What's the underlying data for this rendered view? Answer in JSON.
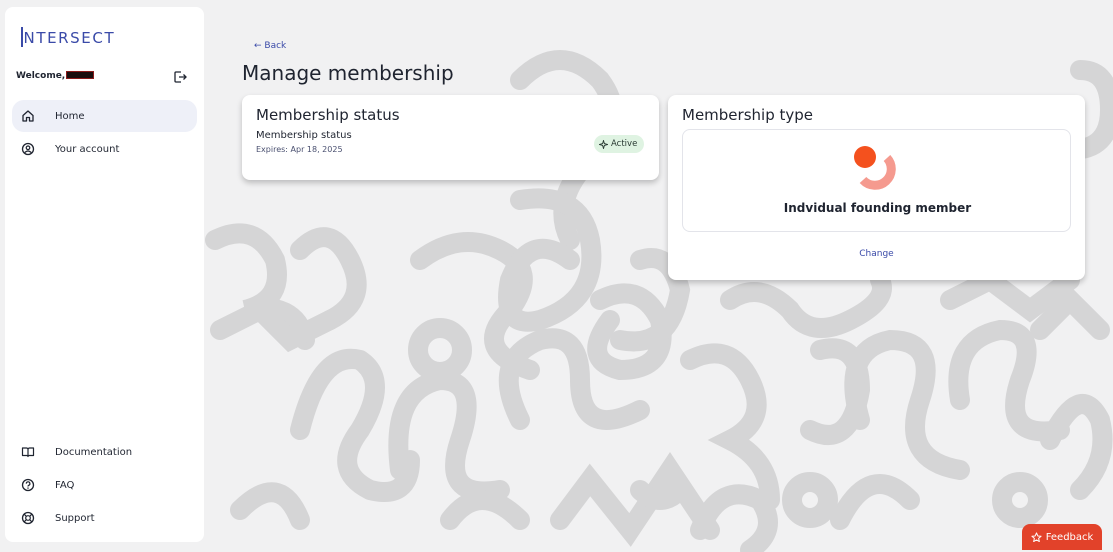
{
  "app": {
    "logo_text": "NTERSECT",
    "logo_prefix": "I"
  },
  "sidebar": {
    "welcome_label": "Welcome,",
    "nav_top": [
      {
        "label": "Home",
        "icon": "home-icon",
        "active": true
      },
      {
        "label": "Your account",
        "icon": "user-circle-icon",
        "active": false
      }
    ],
    "nav_bottom": [
      {
        "label": "Documentation",
        "icon": "book-icon"
      },
      {
        "label": "FAQ",
        "icon": "question-circle-icon"
      },
      {
        "label": "Support",
        "icon": "lifebuoy-icon"
      }
    ]
  },
  "main": {
    "back_label": "← Back",
    "page_title": "Manage membership",
    "status_card": {
      "title": "Membership status",
      "status_label": "Membership status",
      "expires": "Expires: Apr 18, 2025",
      "badge": "Active"
    },
    "type_card": {
      "title": "Membership type",
      "type_name": "Indvidual founding member",
      "change_label": "Change"
    }
  },
  "feedback": {
    "label": "Feedback"
  },
  "colors": {
    "accent": "#3a4aa8",
    "badge_bg": "#dff3e2",
    "feedback_bg": "#e2422a",
    "logo_orange": "#f4511e",
    "logo_pink": "#f59a8f"
  }
}
